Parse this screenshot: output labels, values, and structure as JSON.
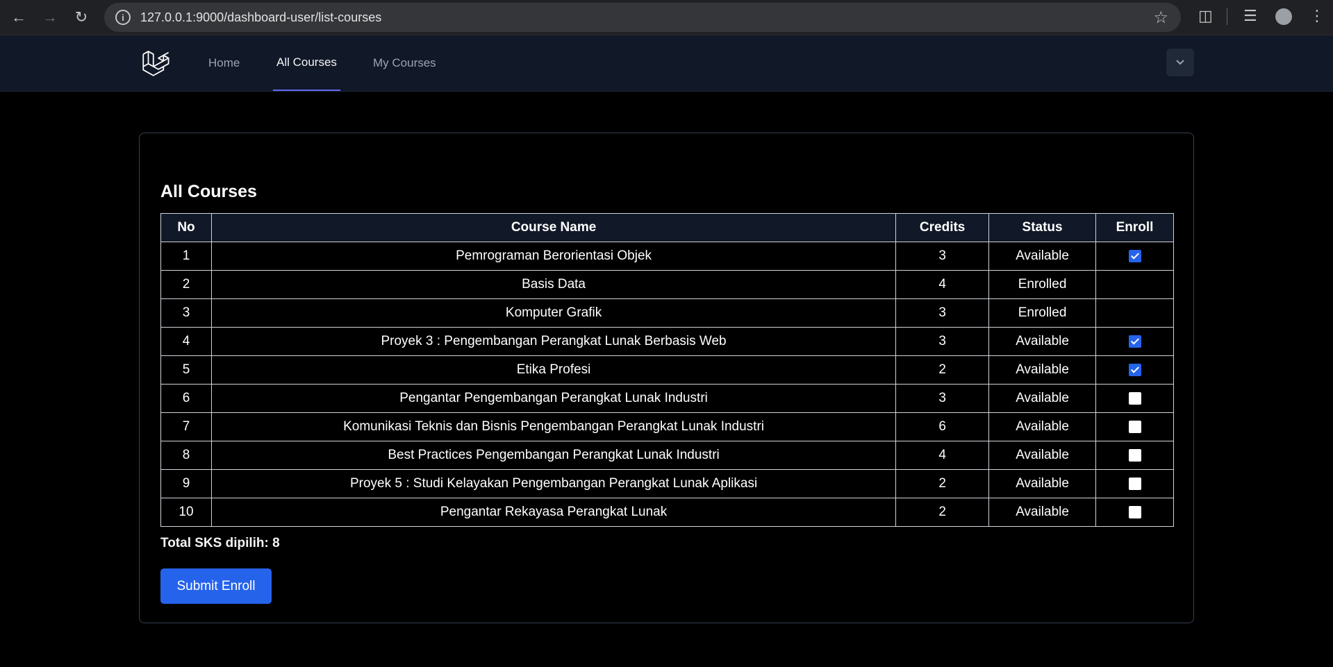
{
  "browser": {
    "url": "127.0.0.1:9000/dashboard-user/list-courses"
  },
  "nav": {
    "items": [
      {
        "label": "Home"
      },
      {
        "label": "All Courses"
      },
      {
        "label": "My Courses"
      }
    ],
    "active": "All Courses"
  },
  "main": {
    "title": "All Courses",
    "columns": [
      "No",
      "Course Name",
      "Credits",
      "Status",
      "Enroll"
    ],
    "rows": [
      {
        "no": "1",
        "name": "Pemrograman Berorientasi Objek",
        "credits": "3",
        "status": "Available",
        "enroll": "checked"
      },
      {
        "no": "2",
        "name": "Basis Data",
        "credits": "4",
        "status": "Enrolled",
        "enroll": "none"
      },
      {
        "no": "3",
        "name": "Komputer Grafik",
        "credits": "3",
        "status": "Enrolled",
        "enroll": "none"
      },
      {
        "no": "4",
        "name": "Proyek 3 : Pengembangan Perangkat Lunak Berbasis Web",
        "credits": "3",
        "status": "Available",
        "enroll": "checked"
      },
      {
        "no": "5",
        "name": "Etika Profesi",
        "credits": "2",
        "status": "Available",
        "enroll": "checked"
      },
      {
        "no": "6",
        "name": "Pengantar Pengembangan Perangkat Lunak Industri",
        "credits": "3",
        "status": "Available",
        "enroll": "unchecked"
      },
      {
        "no": "7",
        "name": "Komunikasi Teknis dan Bisnis Pengembangan Perangkat Lunak Industri",
        "credits": "6",
        "status": "Available",
        "enroll": "unchecked"
      },
      {
        "no": "8",
        "name": "Best Practices Pengembangan Perangkat Lunak Industri",
        "credits": "4",
        "status": "Available",
        "enroll": "unchecked"
      },
      {
        "no": "9",
        "name": "Proyek 5 : Studi Kelayakan Pengembangan Perangkat Lunak Aplikasi",
        "credits": "2",
        "status": "Available",
        "enroll": "unchecked"
      },
      {
        "no": "10",
        "name": "Pengantar Rekayasa Perangkat Lunak",
        "credits": "2",
        "status": "Available",
        "enroll": "unchecked"
      }
    ],
    "total_label": "Total SKS dipilih: 8",
    "submit_label": "Submit Enroll"
  },
  "colors": {
    "accent": "#2563eb",
    "nav_bg": "#111827",
    "active_underline": "#6366f1"
  }
}
